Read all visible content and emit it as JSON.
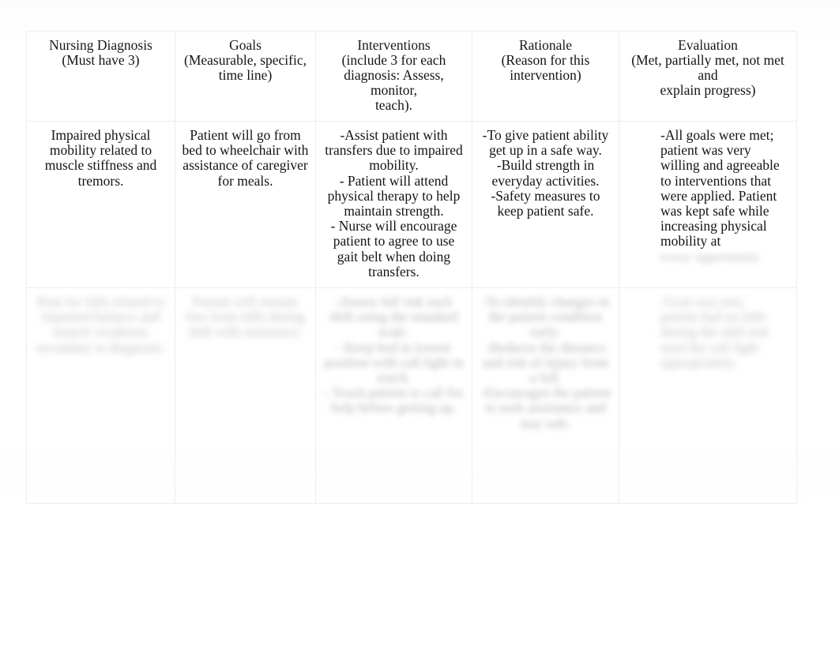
{
  "document": {
    "type": "nursing-care-plan-table",
    "columns": 5,
    "rows": 3,
    "background_color": "#ffffff",
    "text_color": "#141414",
    "border_color": "#ececec"
  },
  "table": {
    "headers": [
      {
        "title": "Nursing Diagnosis",
        "subtitle": "(Must have 3)"
      },
      {
        "title": "Goals",
        "subtitle": "(Measurable, specific,\ntime line)"
      },
      {
        "title": "Interventions",
        "subtitle": "(include 3 for each\ndiagnosis: Assess, monitor,\nteach)."
      },
      {
        "title": "Rationale",
        "subtitle": "(Reason for this\nintervention)"
      },
      {
        "title": "Evaluation",
        "subtitle": "(Met, partially met, not met and\nexplain progress)"
      }
    ],
    "rows": [
      {
        "id": "row-1",
        "redacted": false,
        "cells": [
          {
            "column": "Nursing Diagnosis",
            "text": "Impaired physical mobility related to muscle stiffness and tremors.",
            "align": "center",
            "redacted": false
          },
          {
            "column": "Goals",
            "text": "Patient will go from bed to wheelchair with assistance of caregiver for meals.",
            "align": "center",
            "redacted": false
          },
          {
            "column": "Interventions",
            "text": "-Assist patient with transfers due to impaired mobility.\n- Patient will attend physical therapy to help maintain strength.\n- Nurse will encourage patient to agree to use gait belt when doing transfers.",
            "align": "center",
            "redacted": false
          },
          {
            "column": "Rationale",
            "text": "-To give patient ability get up in a safe way.\n-Build strength in everyday activities.\n-Safety measures to keep patient safe.",
            "align": "center",
            "redacted": false
          },
          {
            "column": "Evaluation",
            "text": "-All goals were met; patient was very willing and agreeable to interventions that were applied. Patient was kept safe while increasing physical mobility at",
            "trailing_redacted_text": "every opportunity.",
            "align": "left",
            "redacted": false,
            "has_redacted_tail": true
          }
        ]
      },
      {
        "id": "row-2",
        "redacted": true,
        "note": "Entire row is blurred/redacted in the source image; text is illegible.",
        "cells": [
          {
            "column": "Nursing Diagnosis",
            "text": "Risk for falls related to impaired balance and muscle weakness secondary to diagnosis.",
            "align": "center",
            "redacted": true
          },
          {
            "column": "Goals",
            "text": "Patient will remain free from falls during shift with assistance.",
            "align": "center",
            "redacted": true
          },
          {
            "column": "Interventions",
            "text": "-Assess fall risk each shift using the standard scale.\n- Keep bed in lowest position with call light in reach.\n- Teach patient to call for help before getting up.",
            "align": "center",
            "redacted": true
          },
          {
            "column": "Rationale",
            "text": "-To identify changes in the patient condition early.\n-Reduces the distance and risk of injury from a fall.\n-Encourages the patient to seek assistance and stay safe.",
            "align": "center",
            "redacted": true
          },
          {
            "column": "Evaluation",
            "text": "-Goal was met; patient had no falls during the shift and used the call light appropriately.",
            "align": "left",
            "redacted": true
          }
        ]
      }
    ]
  }
}
